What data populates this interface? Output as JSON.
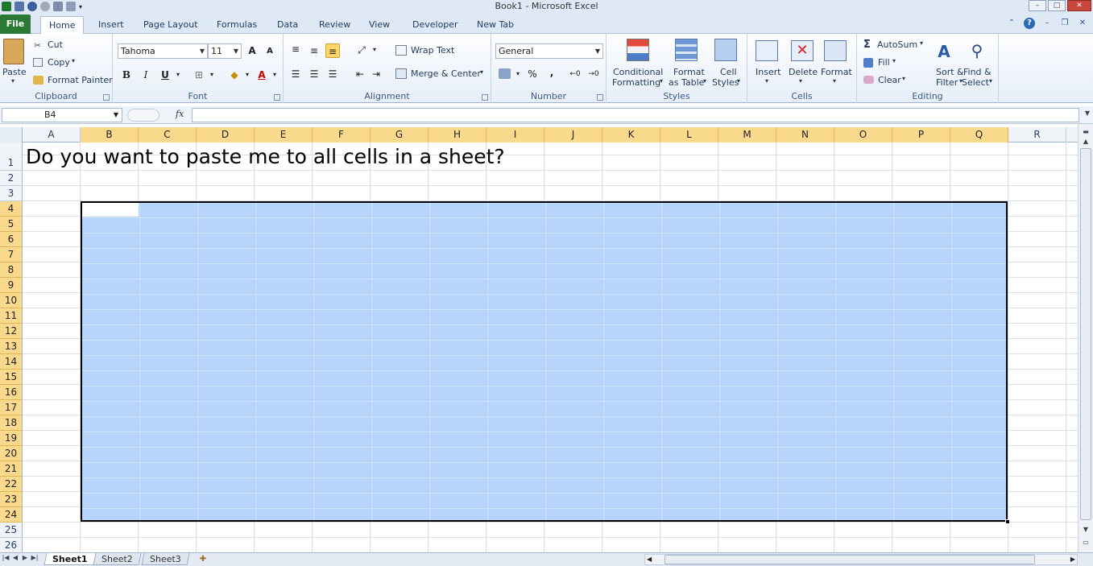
{
  "window": {
    "title": "Book1  -  Microsoft Excel",
    "min": "–",
    "max": "□",
    "close": "✕"
  },
  "tabs": [
    "File",
    "Home",
    "Insert",
    "Page Layout",
    "Formulas",
    "Data",
    "Review",
    "View",
    "Developer",
    "New Tab"
  ],
  "ribbon": {
    "clipboard": {
      "label": "Clipboard",
      "paste": "Paste",
      "cut": "Cut",
      "copy": "Copy",
      "format_painter": "Format Painter"
    },
    "font": {
      "label": "Font",
      "name": "Tahoma",
      "size": "11",
      "bold": "B",
      "italic": "I",
      "underline": "U",
      "grow": "A",
      "shrink": "A"
    },
    "alignment": {
      "label": "Alignment",
      "wrap": "Wrap Text",
      "merge": "Merge & Center"
    },
    "number": {
      "label": "Number",
      "format": "General",
      "percent": "%",
      "comma": ","
    },
    "styles": {
      "label": "Styles",
      "conditional1": "Conditional",
      "conditional2": "Formatting",
      "table1": "Format",
      "table2": "as Table",
      "cell1": "Cell",
      "cell2": "Styles"
    },
    "cells": {
      "label": "Cells",
      "insert": "Insert",
      "delete": "Delete",
      "format": "Format"
    },
    "editing": {
      "label": "Editing",
      "autosum": "AutoSum",
      "fill": "Fill",
      "clear": "Clear",
      "sort1": "Sort &",
      "sort2": "Filter",
      "find1": "Find &",
      "find2": "Select"
    }
  },
  "formula_bar": {
    "name_box": "B4",
    "fx": "fx",
    "formula": ""
  },
  "columns": [
    "A",
    "B",
    "C",
    "D",
    "E",
    "F",
    "G",
    "H",
    "I",
    "J",
    "K",
    "L",
    "M",
    "N",
    "O",
    "P",
    "Q",
    "R"
  ],
  "rows": [
    "1",
    "2",
    "3",
    "4",
    "5",
    "6",
    "7",
    "8",
    "9",
    "10",
    "11",
    "12",
    "13",
    "14",
    "15",
    "16",
    "17",
    "18",
    "19",
    "20",
    "21",
    "22",
    "23",
    "24",
    "25",
    "26"
  ],
  "cells": {
    "A1": "Do you want to paste me to all cells in a sheet?"
  },
  "selection": {
    "range": "B4:Q24",
    "active": "B4"
  },
  "sheets": [
    "Sheet1",
    "Sheet2",
    "Sheet3"
  ],
  "colors": {
    "selection": "#aacefa",
    "header_selected": "#f9d98b",
    "file_tab": "#2a7a34"
  }
}
